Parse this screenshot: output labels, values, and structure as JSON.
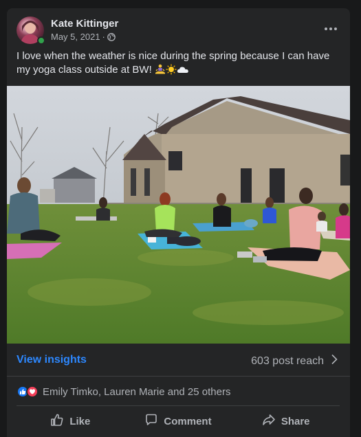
{
  "post": {
    "author": "Kate Kittinger",
    "date": "May 5, 2021",
    "separator": "·",
    "privacy_icon": "globe-icon",
    "text": "I love when the weather is nice during the spring because I can have my yoga class outside at BW!",
    "emojis": [
      "person-meditating-emoji",
      "sun-emoji",
      "cloud-emoji"
    ],
    "more_icon": "more-options-icon"
  },
  "insights": {
    "link": "View insights",
    "reach": "603 post reach"
  },
  "reactions": {
    "icons": [
      "like-reaction-icon",
      "love-reaction-icon"
    ],
    "summary": "Emily Timko, Lauren Marie and 25 others"
  },
  "actions": {
    "like": "Like",
    "comment": "Comment",
    "share": "Share"
  },
  "colors": {
    "background": "#18191a",
    "card": "#242526",
    "link_blue": "#2d88ff",
    "secondary_text": "#b0b3b8",
    "like_blue": "#1877f2",
    "love_red": "#f33e58"
  }
}
